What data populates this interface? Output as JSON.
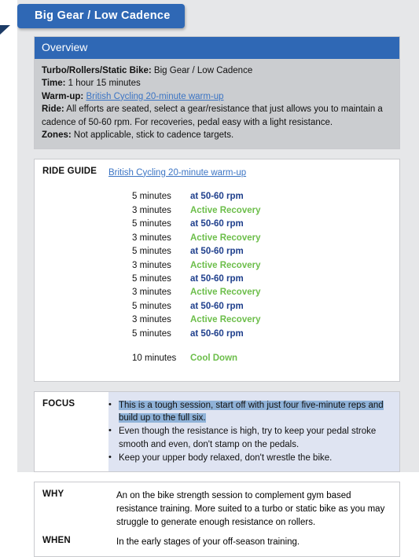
{
  "header": {
    "title": "Big Gear / Low Cadence",
    "accent_color": "#2f68b5",
    "tail_color": "#1c3b66"
  },
  "overview": {
    "heading": "Overview",
    "rows": [
      {
        "label": "Turbo/Rollers/Static Bike:",
        "value": " Big Gear / Low Cadence"
      },
      {
        "label": "Time:",
        "value": " 1 hour 15 minutes"
      },
      {
        "label": "Warm-up:",
        "value": "",
        "link": "British Cycling 20-minute warm-up"
      },
      {
        "label": "Ride:",
        "value": " All efforts are seated, select a gear/resistance that just allows you to maintain a cadence of 50-60 rpm. For recoveries, pedal easy with a light resistance."
      },
      {
        "label": "Zones:",
        "value": " Not applicable, stick to cadence targets."
      }
    ]
  },
  "ride_guide": {
    "label": "RIDE GUIDE",
    "warmup_link": "British Cycling 20-minute warm-up",
    "rows": [
      {
        "duration": "5 minutes",
        "description": "at 50-60 rpm",
        "kind": "effort"
      },
      {
        "duration": "3 minutes",
        "description": "Active Recovery",
        "kind": "recovery"
      },
      {
        "duration": "5 minutes",
        "description": "at 50-60 rpm",
        "kind": "effort"
      },
      {
        "duration": "3 minutes",
        "description": "Active Recovery",
        "kind": "recovery"
      },
      {
        "duration": "5 minutes",
        "description": "at 50-60 rpm",
        "kind": "effort"
      },
      {
        "duration": "3 minutes",
        "description": "Active Recovery",
        "kind": "recovery"
      },
      {
        "duration": "5 minutes",
        "description": "at 50-60 rpm",
        "kind": "effort"
      },
      {
        "duration": "3 minutes",
        "description": "Active Recovery",
        "kind": "recovery"
      },
      {
        "duration": "5 minutes",
        "description": "at 50-60 rpm",
        "kind": "effort"
      },
      {
        "duration": "3 minutes",
        "description": "Active Recovery",
        "kind": "recovery"
      },
      {
        "duration": "5 minutes",
        "description": "at 50-60 rpm",
        "kind": "effort"
      }
    ],
    "cooldown": {
      "duration": "10 minutes",
      "description": "Cool Down",
      "kind": "recovery"
    },
    "effort_color": "#1f3f8c",
    "recovery_color": "#6cbe4a"
  },
  "focus": {
    "label": "FOCUS",
    "bullet_glyph": "•",
    "items": [
      {
        "highlighted": "This is a tough session, start off with just four five-minute reps and build up to the full six.",
        "rest": ""
      },
      {
        "highlighted": "",
        "rest": "Even though the resistance is high, try to keep your pedal stroke smooth and even, don't stamp on the pedals."
      },
      {
        "highlighted": "",
        "rest": "Keep your upper body relaxed, don't wrestle the bike."
      }
    ],
    "background": "#dfe4f2",
    "selection_color": "#8fb2d8"
  },
  "why_when": {
    "why_label": "WHY",
    "why_text": "An on the bike strength session to complement gym based resistance training. More suited to a turbo or static bike as you may struggle to generate enough resistance on rollers.",
    "when_label": "WHEN",
    "when_text": "In the early stages of your off-season training."
  }
}
